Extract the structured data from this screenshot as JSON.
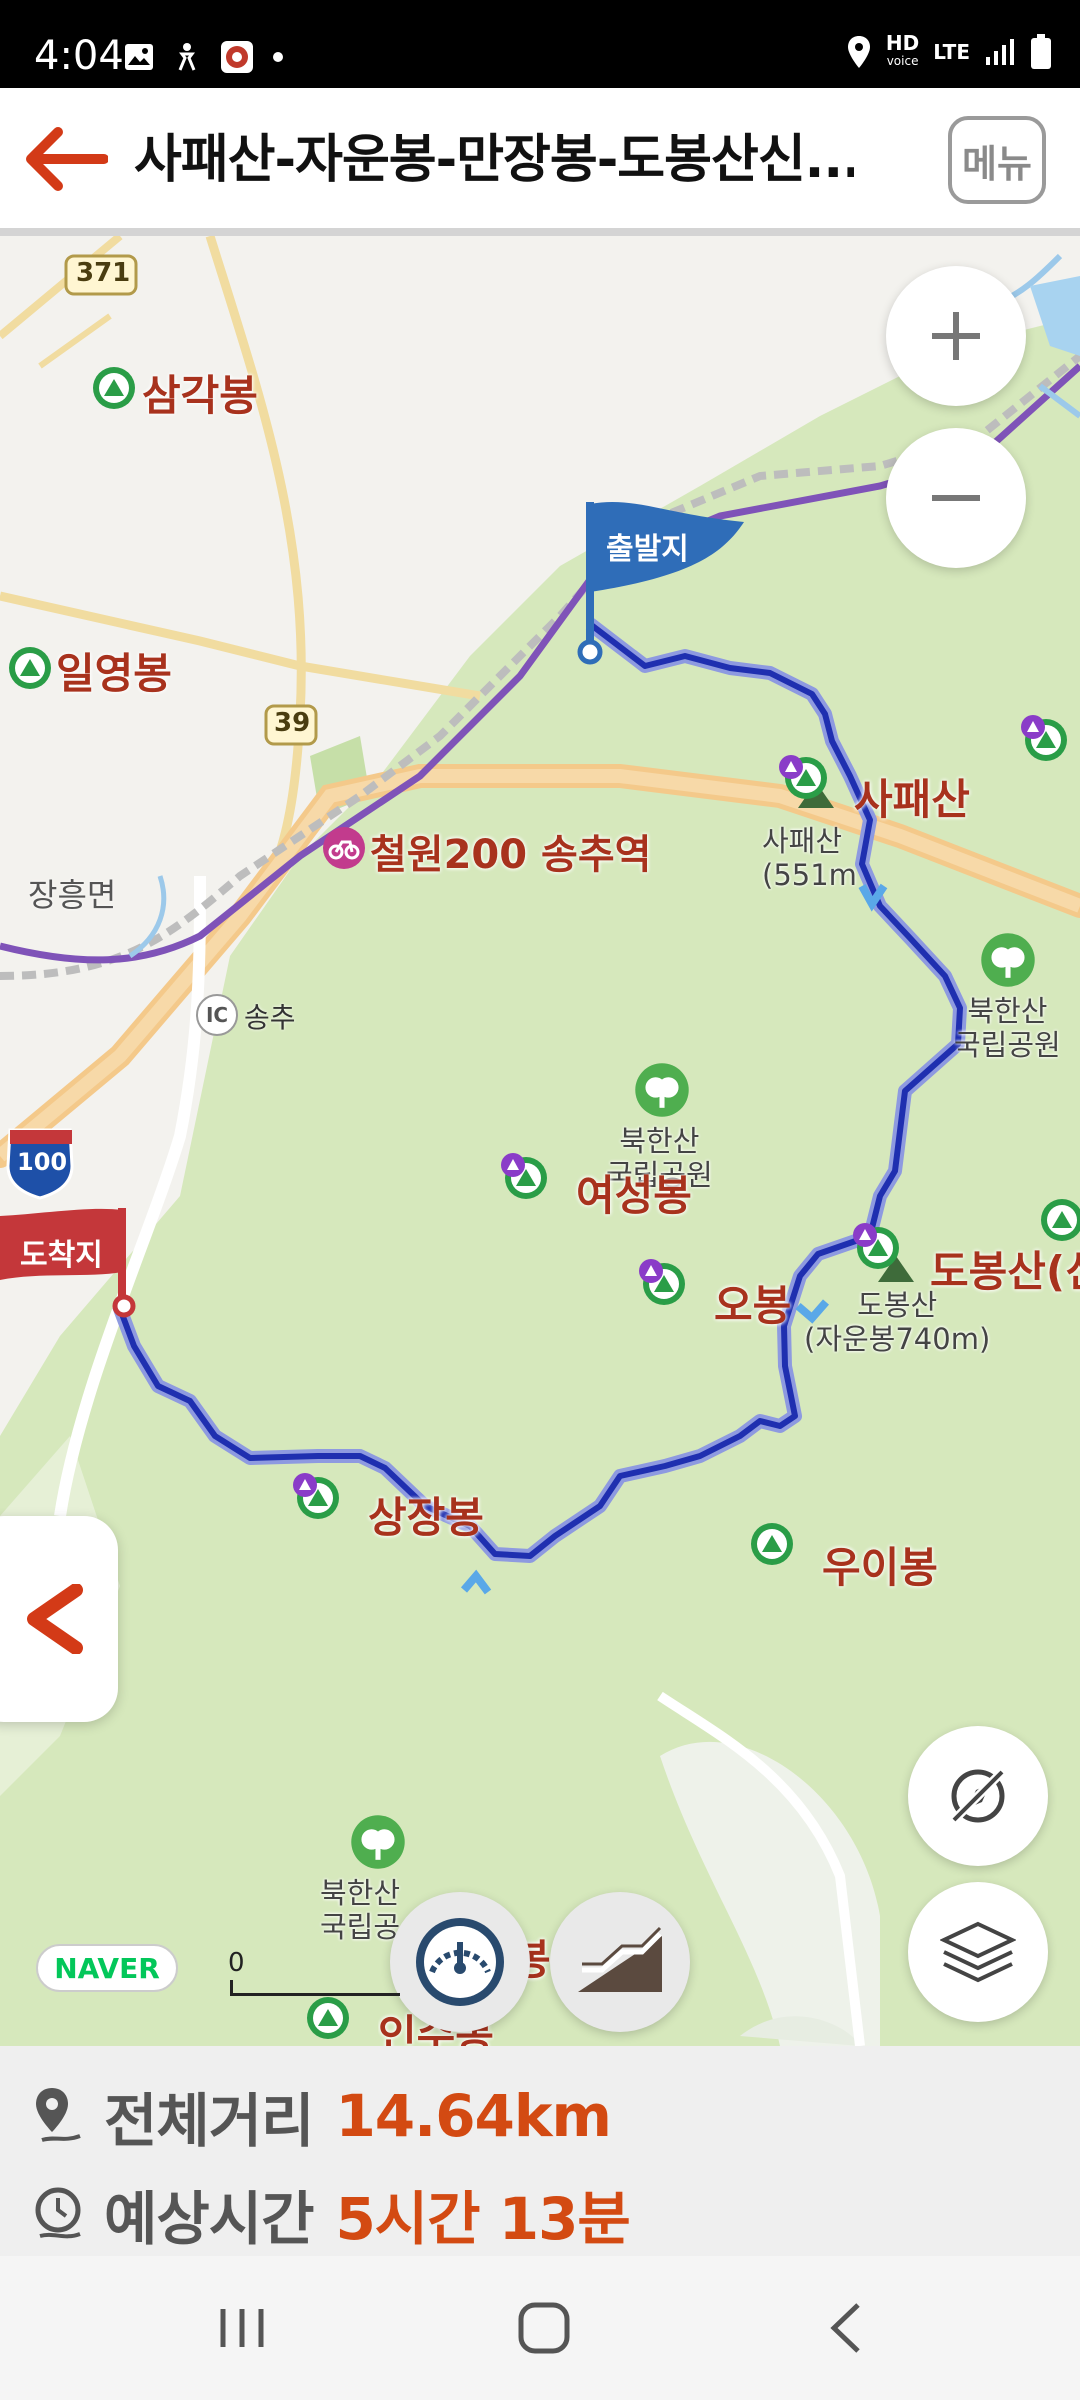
{
  "status_bar": {
    "time": "4:04",
    "network_label": "HD",
    "network_sub": "voice",
    "lte": "LTE"
  },
  "header": {
    "title": "사패산-자운봉-만장봉-도봉산신...",
    "menu_label": "메뉴"
  },
  "map": {
    "road_numbers": [
      "371",
      "39",
      "100"
    ],
    "labels": {
      "samgakbong": "삼각봉",
      "ilyeongbong": "일영봉",
      "janghueongmyeon": "장흥면",
      "station": "철원200 송추역",
      "ic_badge": "IC",
      "songchu": "송추",
      "sapaesan": "사패산",
      "sapaesan_peak": "사패산\n(551m",
      "bukhansan_park_1": "북한산\n국립공원",
      "bukhansan_park_2": "북한산\n국립공원",
      "bukhansan_park_3": "북한산\n국립공",
      "yeoseongbong": "여성봉",
      "obong": "오봉",
      "dobongsan": "도봉산(신",
      "dobongsan_peak": "도봉산\n(자운봉740m)",
      "sangjangbong": "상장봉",
      "uibong": "우이봉",
      "insubong_partial": "인수봉",
      "bottom_partial": "봉"
    },
    "start_flag": "출발지",
    "end_flag": "도착지",
    "attribution": "NAVER",
    "scale_zero": "0",
    "colors": {
      "route": "#1f2fb0",
      "route_glow": "#7f8ddb",
      "park_green": "#d5e8b9",
      "start_flag": "#2f6db8",
      "end_flag": "#c4373a",
      "label_red": "#a8321d",
      "accent_orange": "#d34a12"
    }
  },
  "summary": {
    "distance_label": "전체거리",
    "distance_value": "14.64km",
    "time_label": "예상시간",
    "time_value": "5시간 13분"
  },
  "icons": {
    "back": "arrow-left-icon",
    "zoom_in": "plus-icon",
    "zoom_out": "minus-icon",
    "compass": "compass-off-icon",
    "layers": "layers-icon",
    "speedometer": "speedometer-icon",
    "elevation": "elevation-icon",
    "collapse": "chevron-left-icon"
  }
}
